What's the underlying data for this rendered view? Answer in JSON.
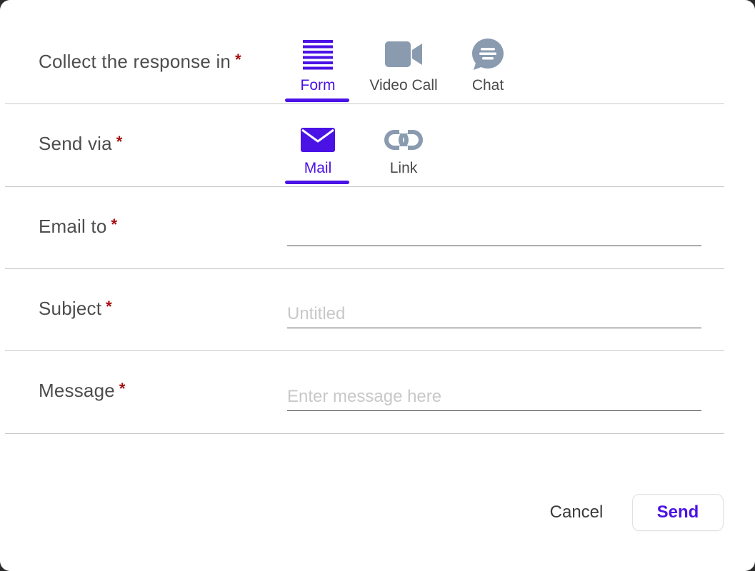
{
  "colors": {
    "accent": "#4b12e6",
    "icon_inactive": "#8a9bb0",
    "required": "#a50d0d",
    "label": "#4d4d4d"
  },
  "collect": {
    "label": "Collect the response in",
    "required_mark": "*",
    "options": [
      {
        "label": "Form",
        "icon": "form-lines-icon",
        "active": true
      },
      {
        "label": "Video Call",
        "icon": "video-camera-icon",
        "active": false
      },
      {
        "label": "Chat",
        "icon": "chat-bubble-icon",
        "active": false
      }
    ]
  },
  "send_via": {
    "label": "Send via",
    "required_mark": "*",
    "options": [
      {
        "label": "Mail",
        "icon": "mail-icon",
        "active": true
      },
      {
        "label": "Link",
        "icon": "link-icon",
        "active": false
      }
    ]
  },
  "email_to": {
    "label": "Email to",
    "required_mark": "*",
    "value": "",
    "placeholder": ""
  },
  "subject": {
    "label": "Subject",
    "required_mark": "*",
    "value": "",
    "placeholder": "Untitled"
  },
  "message": {
    "label": "Message",
    "required_mark": "*",
    "value": "",
    "placeholder": "Enter message here"
  },
  "actions": {
    "cancel_label": "Cancel",
    "send_label": "Send"
  }
}
